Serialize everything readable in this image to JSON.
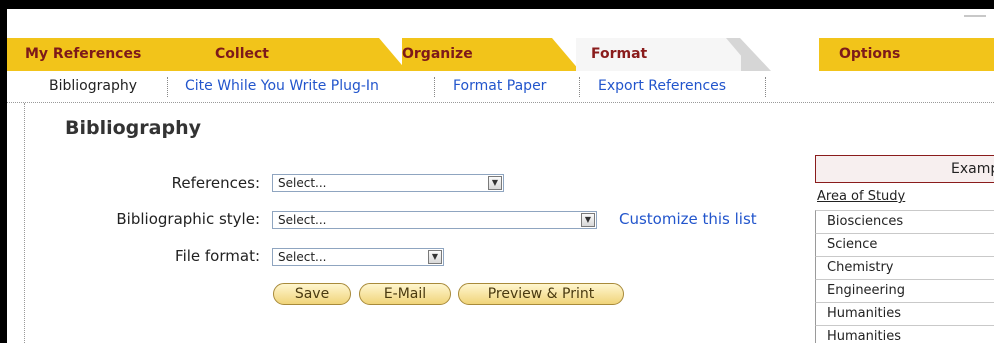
{
  "tabs": [
    {
      "label": "My References"
    },
    {
      "label": "Collect"
    },
    {
      "label": "Organize"
    },
    {
      "label": "Format",
      "active": true
    },
    {
      "label": "Options"
    }
  ],
  "subnav": [
    {
      "label": "Bibliography",
      "current": true
    },
    {
      "label": "Cite While You Write Plug-In"
    },
    {
      "label": "Format Paper"
    },
    {
      "label": "Export References"
    }
  ],
  "page": {
    "heading": "Bibliography",
    "form": {
      "references_label": "References:",
      "references_value": "Select...",
      "style_label": "Bibliographic style:",
      "style_value": "Select...",
      "customize_link": "Customize this list",
      "file_format_label": "File format:",
      "file_format_value": "Select..."
    },
    "buttons": {
      "save": "Save",
      "email": "E-Mail",
      "preview": "Preview & Print"
    }
  },
  "examples": {
    "header": "Example",
    "area_label": "Area of Study",
    "rows": [
      "Biosciences",
      "Science",
      "Chemistry",
      "Engineering",
      "Humanities",
      "Humanities"
    ]
  },
  "colors": {
    "tab_yellow": "#f2c41a",
    "tab_text": "#7d1a1a",
    "link_blue": "#2255cc",
    "button_fill": "#f0d47a"
  }
}
